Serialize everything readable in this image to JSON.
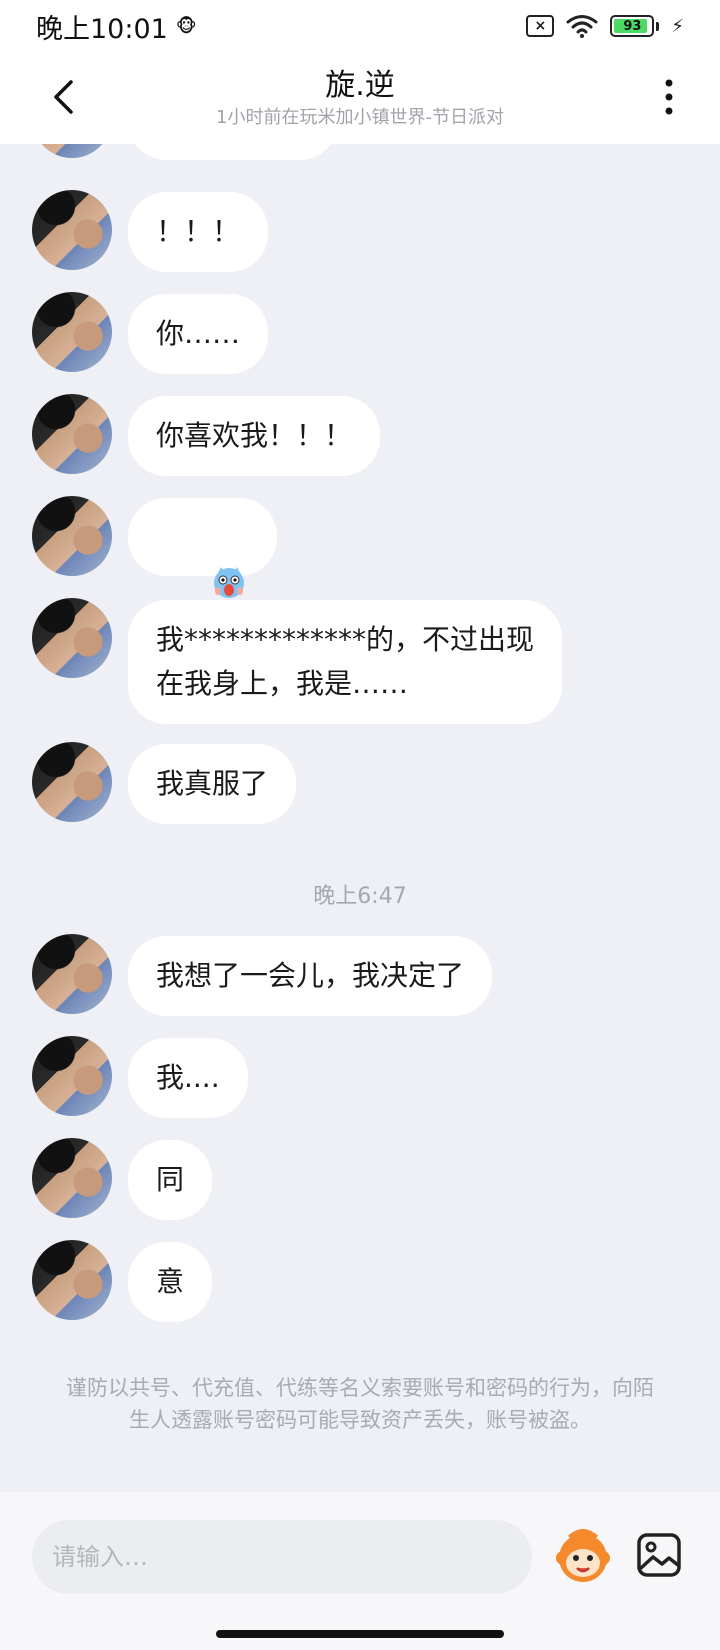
{
  "status_bar": {
    "time": "晚上10:01",
    "battery_level": 93,
    "battery_text": "93"
  },
  "header": {
    "name": "旋.逆",
    "status": "1小时前在玩米加小镇世界-节日派对"
  },
  "messages_before": [
    {
      "text": "！！！"
    },
    {
      "text": "你……"
    },
    {
      "text": "你喜欢我！！！"
    },
    {
      "sticker": "surprised-face-sticker"
    },
    {
      "text": "我*************的，不过出现\n在我身上，我是……"
    },
    {
      "text": "我真服了"
    }
  ],
  "time_divider": "晚上6:47",
  "messages_after": [
    {
      "text": "我想了一会儿，我决定了"
    },
    {
      "text": "我...."
    },
    {
      "text": "同"
    },
    {
      "text": "意"
    }
  ],
  "warning_text": "谨防以共号、代充值、代练等名义索要账号和密码的行为，向陌生人透露账号密码可能导致资产丢失，账号被盗。",
  "input": {
    "placeholder": "请输入…"
  },
  "colors": {
    "background": "#eef0f5",
    "bubble": "#ffffff",
    "battery_fill": "#4cd964"
  }
}
